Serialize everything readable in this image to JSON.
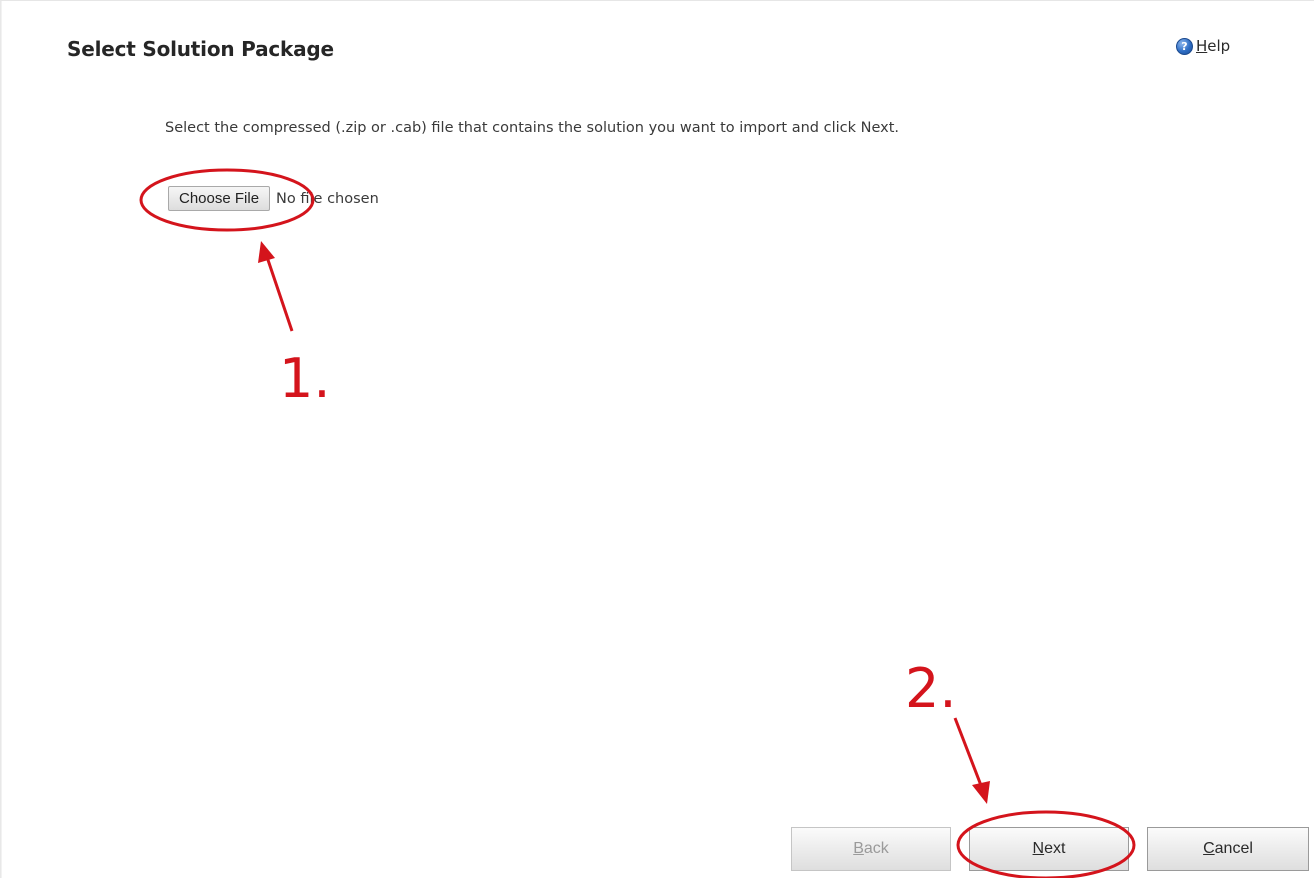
{
  "dialog": {
    "title": "Select Solution Package",
    "help_label": "Help",
    "help_icon": "help-icon",
    "help_icon_glyph": "?",
    "instructions": "Select the compressed (.zip or .cab) file that contains the solution you want to import and click Next.",
    "choose_file_label": "Choose File",
    "file_status": "No file chosen"
  },
  "footer": {
    "back_label": "Back",
    "next_label": "Next",
    "cancel_label": "Cancel",
    "back_enabled": false
  },
  "annotations": {
    "color": "#d4141c",
    "step1_label": "1.",
    "step2_label": "2."
  }
}
